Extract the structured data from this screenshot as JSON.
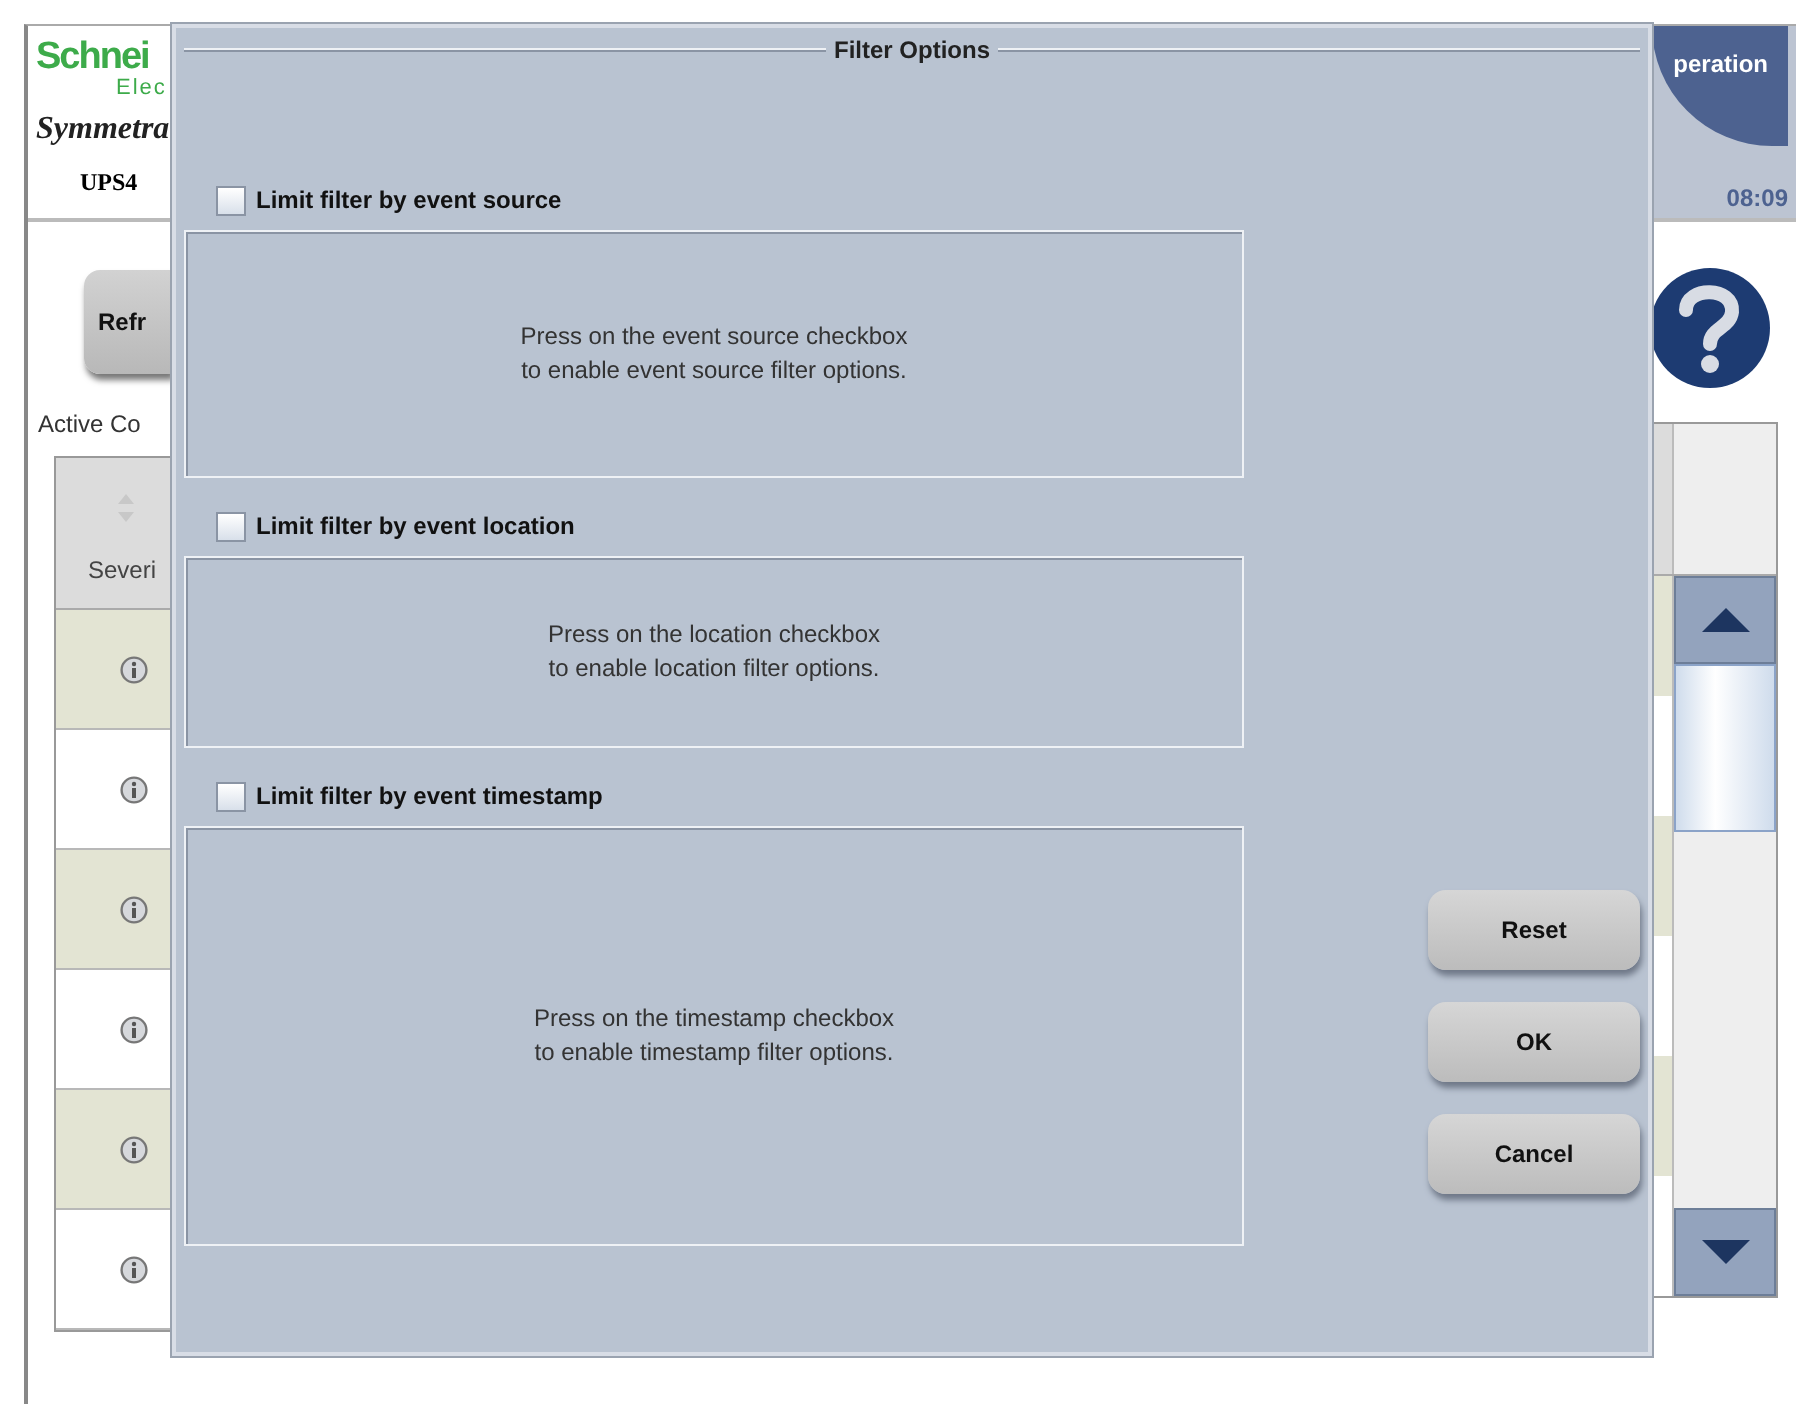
{
  "header": {
    "brand": "Schnei",
    "brand_sub": "Elec",
    "product": "Symmetra",
    "device": "UPS4",
    "mode": "peration",
    "time": "08:09"
  },
  "refresh_button": "Refr",
  "active_label": "Active Co",
  "table": {
    "columns": [
      {
        "label": "Severi"
      }
    ],
    "rows": [
      {
        "kind": "info"
      },
      {
        "kind": "info"
      },
      {
        "kind": "info"
      },
      {
        "kind": "info"
      },
      {
        "kind": "info"
      },
      {
        "kind": "info"
      }
    ]
  },
  "dialog": {
    "title": "Filter Options",
    "filters": [
      {
        "label": "Limit filter by event source",
        "checked": false,
        "hint": "Press on the event source checkbox\nto enable event source filter options."
      },
      {
        "label": "Limit filter by event location",
        "checked": false,
        "hint": "Press on the location checkbox\nto enable location filter options."
      },
      {
        "label": "Limit filter by event timestamp",
        "checked": false,
        "hint": "Press on the timestamp checkbox\nto enable timestamp filter options."
      }
    ],
    "buttons": [
      "Reset",
      "OK",
      "Cancel"
    ]
  }
}
